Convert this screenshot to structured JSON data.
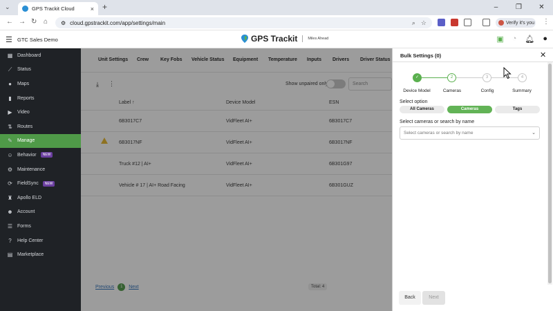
{
  "browser": {
    "tab_title": "GPS Trackit Cloud",
    "url": "cloud.gpstrackit.com/app/settings/main",
    "profile_label": "Verify it's you"
  },
  "header": {
    "company": "GTC Sales Demo",
    "brand": "GPS Trackit",
    "tagline": "Miles Ahead"
  },
  "sidebar": {
    "items": [
      {
        "label": "Dashboard",
        "icon": "dashboard-icon"
      },
      {
        "label": "Status",
        "icon": "status-icon"
      },
      {
        "label": "Maps",
        "icon": "map-pin-icon"
      },
      {
        "label": "Reports",
        "icon": "bar-chart-icon"
      },
      {
        "label": "Video",
        "icon": "video-icon"
      },
      {
        "label": "Routes",
        "icon": "routes-icon"
      },
      {
        "label": "Manage",
        "icon": "wrench-icon",
        "active": true
      },
      {
        "label": "Behavior",
        "icon": "person-icon",
        "badge": "NEW"
      },
      {
        "label": "Maintenance",
        "icon": "maintenance-icon"
      },
      {
        "label": "FieldSync",
        "icon": "fieldsync-icon",
        "badge": "NEW"
      },
      {
        "label": "Apollo ELD",
        "icon": "eld-icon"
      },
      {
        "label": "Account",
        "icon": "account-icon"
      },
      {
        "label": "Forms",
        "icon": "forms-icon"
      },
      {
        "label": "Help Center",
        "icon": "help-icon"
      },
      {
        "label": "Marketplace",
        "icon": "marketplace-icon"
      }
    ]
  },
  "main": {
    "tabs": [
      "Unit Settings",
      "Crew",
      "Key Fobs",
      "Vehicle Status",
      "Equipment",
      "Temperature",
      "Inputs",
      "Drivers",
      "Driver Status"
    ],
    "show_unpaired_label": "Show unpaired only",
    "search_placeholder": "Search",
    "columns": [
      "Label ↑",
      "Device Model",
      "ESN"
    ],
    "rows": [
      {
        "label": "6B3017C7",
        "model": "VidFleet AI+",
        "esn": "6B3017C7",
        "warning": false
      },
      {
        "label": "6B3017NF",
        "model": "VidFleet AI+",
        "esn": "6B3017NF",
        "warning": true
      },
      {
        "label": "Truck #12 | AI+",
        "model": "VidFleet AI+",
        "esn": "6B301G97",
        "warning": false
      },
      {
        "label": "Vehicle # 17 | AI+ Road Facing",
        "model": "VidFleet AI+",
        "esn": "6B301GUZ",
        "warning": false
      }
    ],
    "pager": {
      "previous": "Previous",
      "page": "1",
      "next": "Next",
      "total": "Total: 4"
    }
  },
  "drawer": {
    "title": "Bulk Settings (0)",
    "steps": [
      {
        "num": "✓",
        "label": "Device Model",
        "state": "done"
      },
      {
        "num": "2",
        "label": "Cameras",
        "state": "current"
      },
      {
        "num": "3",
        "label": "Config",
        "state": "todo"
      },
      {
        "num": "4",
        "label": "Summary",
        "state": "todo"
      }
    ],
    "select_option_label": "Select option",
    "options": [
      "All Cameras",
      "Cameras",
      "Tags"
    ],
    "selected_option": "Cameras",
    "search_label": "Select cameras or search by name",
    "dropdown_placeholder": "Select cameras or search by name",
    "back_label": "Back",
    "next_label": "Next"
  },
  "colors": {
    "accent_green": "#5bb04f",
    "sidebar_bg": "#1f2226",
    "badge_purple": "#6b3fa0"
  }
}
